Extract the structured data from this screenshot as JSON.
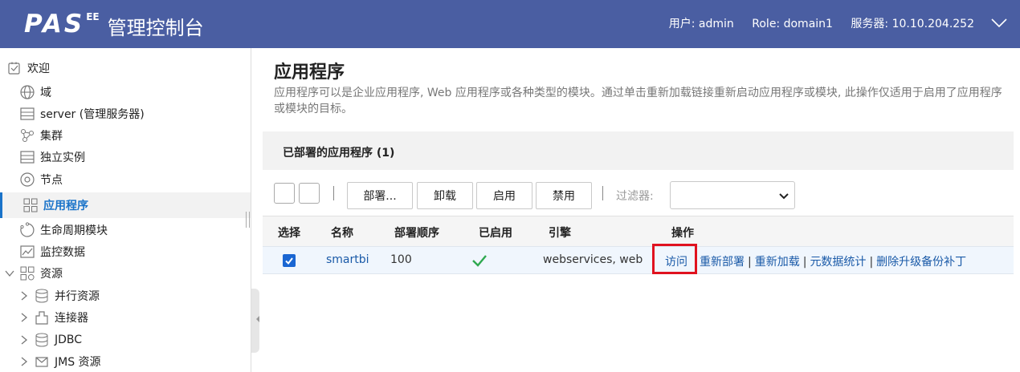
{
  "header": {
    "logo_text": "PAS",
    "logo_sup": "EE",
    "title": "管理控制台",
    "user": "用户: admin",
    "role": "Role: domain1",
    "server": "服务器: 10.10.204.252"
  },
  "sidebar": {
    "items": [
      {
        "label": "欢迎",
        "icon": "welcome-icon"
      },
      {
        "label": "域",
        "icon": "globe-icon"
      },
      {
        "label": "server (管理服务器)",
        "icon": "server-icon"
      },
      {
        "label": "集群",
        "icon": "cluster-icon"
      },
      {
        "label": "独立实例",
        "icon": "instance-icon"
      },
      {
        "label": "节点",
        "icon": "node-icon"
      },
      {
        "label": "应用程序",
        "icon": "apps-icon",
        "active": true
      },
      {
        "label": "生命周期模块",
        "icon": "lifecycle-icon"
      },
      {
        "label": "监控数据",
        "icon": "monitor-icon"
      },
      {
        "label": "资源",
        "icon": "resources-icon",
        "expanded": true
      },
      {
        "label": "并行资源",
        "icon": "database-icon"
      },
      {
        "label": "连接器",
        "icon": "connector-icon"
      },
      {
        "label": "JDBC",
        "icon": "database-icon"
      },
      {
        "label": "JMS 资源",
        "icon": "jms-icon"
      }
    ]
  },
  "main": {
    "title": "应用程序",
    "description": "应用程序可以是企业应用程序, Web 应用程序或各种类型的模块。通过单击重新加载链接重新启动应用程序或模块, 此操作仅适用于启用了应用程序或模块的目标。",
    "section_title": "已部署的应用程序 (1)",
    "toolbar": {
      "deploy": "部署...",
      "undeploy": "卸载",
      "enable": "启用",
      "disable": "禁用",
      "filter_label": "过滤器:",
      "filter_value": ""
    },
    "table": {
      "headers": [
        "选择",
        "名称",
        "部署顺序",
        "已启用",
        "引擎",
        "操作"
      ],
      "rows": [
        {
          "selected": true,
          "name": "smartbi",
          "order": "100",
          "enabled": true,
          "engine": "webservices, web",
          "actions": [
            "访问",
            "重新部署",
            "重新加载",
            "元数据统计",
            "删除升级备份补丁"
          ]
        }
      ]
    }
  },
  "colors": {
    "header_bg": "#4a5ea2",
    "accent": "#1a73c9",
    "link": "#1a5aa8",
    "highlight_box": "#e0121f",
    "enabled_check": "#2ea84f"
  }
}
